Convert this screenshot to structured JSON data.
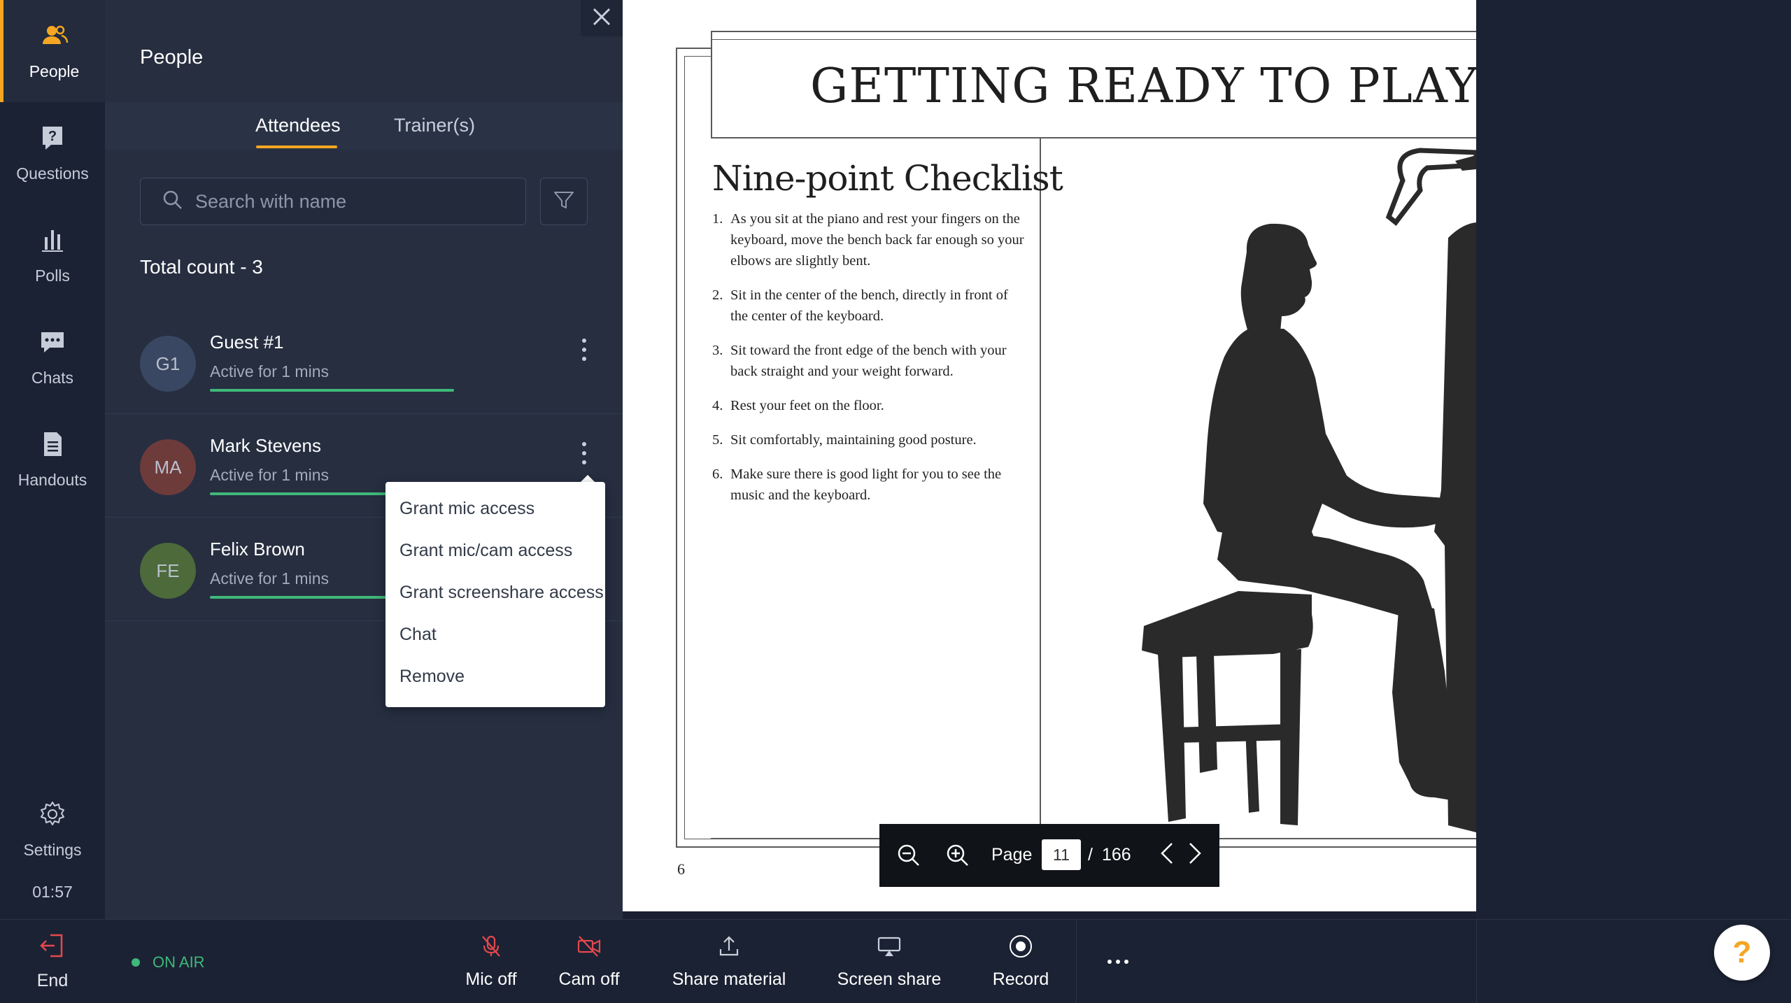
{
  "rail": {
    "items": [
      {
        "label": "People",
        "icon": "people-icon",
        "active": true
      },
      {
        "label": "Questions",
        "icon": "question-icon"
      },
      {
        "label": "Polls",
        "icon": "polls-icon"
      },
      {
        "label": "Chats",
        "icon": "chat-icon"
      },
      {
        "label": "Handouts",
        "icon": "handout-icon"
      }
    ],
    "settings_label": "Settings",
    "timer": "01:57"
  },
  "panel": {
    "title": "People",
    "tabs": [
      {
        "label": "Attendees",
        "active": true
      },
      {
        "label": "Trainer(s)",
        "active": false
      }
    ],
    "search_placeholder": "Search with name",
    "total_count": "Total count - 3",
    "attendees": [
      {
        "initials": "G1",
        "name": "Guest #1",
        "status": "Active for 1 mins",
        "avatar_color": "#3a4762",
        "progress": 1.0
      },
      {
        "initials": "MA",
        "name": "Mark Stevens",
        "status": "Active for 1 mins",
        "avatar_color": "#6e3b3b",
        "progress": 1.0
      },
      {
        "initials": "FE",
        "name": "Felix Brown",
        "status": "Active for 1 mins",
        "avatar_color": "#4c6a3a",
        "progress": 1.0
      }
    ],
    "context_menu": [
      "Grant mic access",
      "Grant mic/cam access",
      "Grant screenshare access",
      "Chat",
      "Remove"
    ]
  },
  "document": {
    "title": "GETTING READY TO PLAY THE",
    "heading": "Nine-point Checklist",
    "items": [
      {
        "num": "1.",
        "text": "As you sit at the piano and rest your fingers on the keyboard, move the bench back far enough so your elbows are slightly bent."
      },
      {
        "num": "2.",
        "text": "Sit in the center of the bench, directly in front of the center of the keyboard."
      },
      {
        "num": "3.",
        "text": "Sit toward the front edge of the bench with your back straight and your weight forward."
      },
      {
        "num": "4.",
        "text": "Rest your feet on the floor."
      },
      {
        "num": "5.",
        "text": "Sit comfortably, maintaining good posture."
      },
      {
        "num": "6.",
        "text": "Make sure there is good light for you to see the music and the keyboard."
      }
    ],
    "page_number": "6"
  },
  "pagebar": {
    "page_label": "Page",
    "current_page": "11",
    "separator": "/",
    "total_pages": "166"
  },
  "bottombar": {
    "end_label": "End",
    "status": "ON AIR",
    "buttons": [
      {
        "label": "Mic off",
        "icon": "mic-off-icon"
      },
      {
        "label": "Cam off",
        "icon": "cam-off-icon"
      },
      {
        "label": "Share material",
        "icon": "share-icon"
      },
      {
        "label": "Screen share",
        "icon": "screen-share-icon"
      },
      {
        "label": "Record",
        "icon": "record-icon"
      }
    ]
  },
  "help_label": "?",
  "colors": {
    "accent": "#f5a623",
    "danger": "#e5484d",
    "success": "#3fb87a",
    "rail_bg": "#1b2233",
    "panel_bg": "#262e40"
  }
}
